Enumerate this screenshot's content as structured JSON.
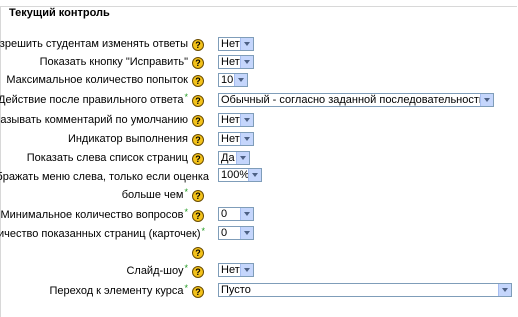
{
  "section_title": "Текущий контроль",
  "rows": [
    {
      "label": "Разрешить студентам изменять ответы",
      "required": false,
      "value": "Нет"
    },
    {
      "label": "Показать кнопку \"Исправить\"",
      "required": false,
      "value": "Нет"
    },
    {
      "label": "Максимальное количество попыток",
      "required": false,
      "value": "10"
    },
    {
      "label": "Действие после правильного ответа",
      "required": true,
      "value": "Обычный - согласно заданной последовательности страниц"
    },
    {
      "label": "Показывать комментарий по умолчанию",
      "required": false,
      "value": "Нет"
    },
    {
      "label": "Индикатор выполнения",
      "required": false,
      "value": "Нет"
    },
    {
      "label": "Показать слева список страниц",
      "required": false,
      "value": "Да"
    },
    {
      "label": "Отображать меню слева, только если оценка",
      "required": false,
      "value": "100%"
    },
    {
      "label": "больше чем",
      "required": true,
      "value": ""
    },
    {
      "label": "Минимальное количество вопросов",
      "required": true,
      "value": "0"
    },
    {
      "label": "Количество показанных страниц (карточек)",
      "required": true,
      "value": "0"
    },
    {
      "label": "Слайд-шоу",
      "required": true,
      "value": "Нет"
    },
    {
      "label": "Переход к элементу курса",
      "required": true,
      "value": "Пусто"
    }
  ],
  "help_glyph": "?",
  "required_glyph": "*",
  "colors": {
    "help_bg": "#f3c21a",
    "required": "#1f9a1f",
    "select_border": "#7f9db9"
  }
}
